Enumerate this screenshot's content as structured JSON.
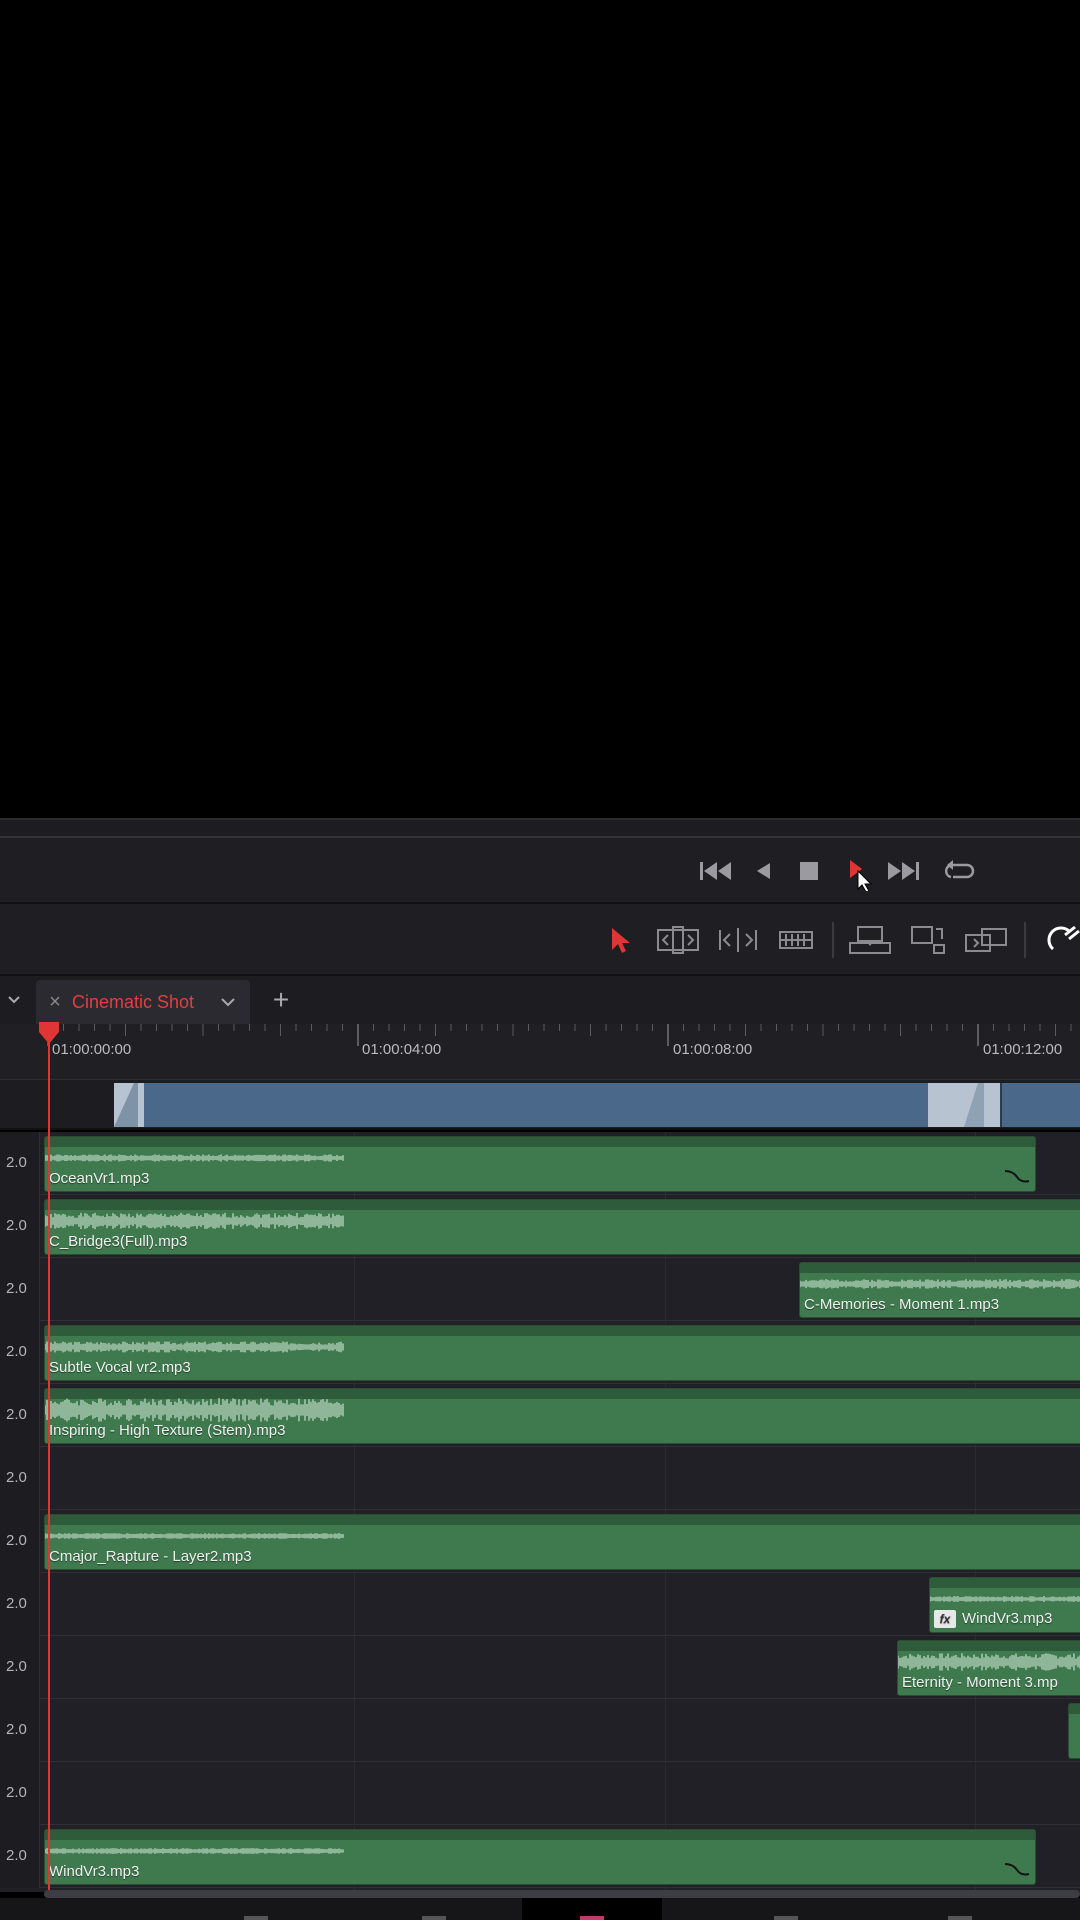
{
  "timeline": {
    "tab_title": "Cinematic Shot",
    "add_tab": "+",
    "close_glyph": "×",
    "timecodes": [
      "01:00:00:00",
      "01:00:04:00",
      "01:00:08:00",
      "01:00:12:00"
    ]
  },
  "tracks": [
    {
      "level": "2.0",
      "clips": [
        {
          "name": "OceanVr1.mp3"
        }
      ]
    },
    {
      "level": "2.0",
      "clips": [
        {
          "name": "C_Bridge3(Full).mp3"
        }
      ]
    },
    {
      "level": "2.0",
      "clips": [
        {
          "name": "C-Memories - Moment 1.mp3"
        }
      ]
    },
    {
      "level": "2.0",
      "clips": [
        {
          "name": "Subtle Vocal vr2.mp3"
        }
      ]
    },
    {
      "level": "2.0",
      "clips": [
        {
          "name": "Inspiring - High Texture (Stem).mp3"
        }
      ]
    },
    {
      "level": "2.0",
      "clips": []
    },
    {
      "level": "2.0",
      "clips": [
        {
          "name": "Cmajor_Rapture - Layer2.mp3"
        }
      ]
    },
    {
      "level": "2.0",
      "clips": [
        {
          "name": "WindVr3.mp3",
          "fx": "fx"
        }
      ]
    },
    {
      "level": "2.0",
      "clips": [
        {
          "name": "Eternity - Moment 3.mp"
        }
      ]
    },
    {
      "level": "2.0",
      "clips": [
        {
          "name": ""
        }
      ]
    },
    {
      "level": "2.0",
      "clips": []
    },
    {
      "level": "2.0",
      "clips": [
        {
          "name": "WindVr3.mp3"
        }
      ]
    }
  ],
  "transport": {
    "icons": [
      "skip-to-start-icon",
      "play-reverse-icon",
      "stop-icon",
      "play-icon",
      "skip-to-end-icon",
      "loop-icon"
    ]
  },
  "toolbar": {
    "icons": [
      "selection-tool-icon",
      "trim-edit-icon",
      "dynamic-trim-icon",
      "blade-icon",
      "insert-clip-icon",
      "overwrite-clip-icon",
      "replace-clip-icon",
      "snapping-icon"
    ]
  },
  "colors": {
    "playhead": "#e03535",
    "clip": "#3f7a4f",
    "video_clip": "#4a6889",
    "tab_label": "#e04040"
  }
}
